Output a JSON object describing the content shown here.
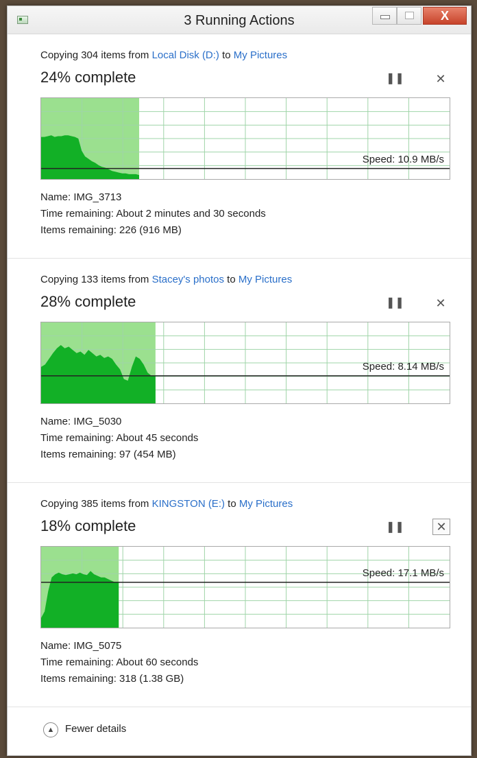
{
  "window": {
    "title": "3 Running Actions",
    "close_glyph": "X"
  },
  "operations": [
    {
      "copy_prefix": "Copying 304 items from ",
      "source": "Local Disk (D:)",
      "to": " to ",
      "destination": "My Pictures",
      "percent_text": "24% complete",
      "progress": 0.24,
      "speed_label": "Speed: 10.9 MB/s",
      "speed_level": 0.13,
      "name": "Name: IMG_3713",
      "time_remaining": "Time remaining:  About 2 minutes and 30 seconds",
      "items_remaining": "Items remaining:  226 (916 MB)",
      "history": [
        0.52,
        0.52,
        0.53,
        0.54,
        0.52,
        0.53,
        0.53,
        0.54,
        0.54,
        0.53,
        0.52,
        0.5,
        0.35,
        0.28,
        0.25,
        0.22,
        0.2,
        0.17,
        0.15,
        0.14,
        0.12,
        0.1,
        0.09,
        0.08,
        0.07,
        0.07,
        0.06,
        0.06,
        0.06,
        0.05
      ]
    },
    {
      "copy_prefix": "Copying 133 items from ",
      "source": "Stacey's photos",
      "to": " to ",
      "destination": "My Pictures",
      "percent_text": "28% complete",
      "progress": 0.28,
      "speed_label": "Speed: 8.14 MB/s",
      "speed_level": 0.34,
      "name": "Name: IMG_5030",
      "time_remaining": "Time remaining:  About 45 seconds",
      "items_remaining": "Items remaining:  97 (454 MB)",
      "history": [
        0.45,
        0.48,
        0.55,
        0.62,
        0.68,
        0.72,
        0.68,
        0.7,
        0.66,
        0.62,
        0.64,
        0.6,
        0.66,
        0.62,
        0.58,
        0.6,
        0.56,
        0.58,
        0.55,
        0.48,
        0.42,
        0.3,
        0.28,
        0.45,
        0.58,
        0.55,
        0.48,
        0.38,
        0.34,
        0.34
      ]
    },
    {
      "copy_prefix": "Copying 385 items from ",
      "source": "KINGSTON (E:)",
      "to": " to ",
      "destination": "My Pictures",
      "percent_text": "18% complete",
      "progress": 0.19,
      "speed_label": "Speed: 17.1 MB/s",
      "speed_level": 0.56,
      "name": "Name: IMG_5075",
      "time_remaining": "Time remaining:  About 60 seconds",
      "items_remaining": "Items remaining:  318 (1.38 GB)",
      "history": [
        0.12,
        0.2,
        0.45,
        0.62,
        0.66,
        0.68,
        0.66,
        0.65,
        0.66,
        0.67,
        0.66,
        0.68,
        0.66,
        0.65,
        0.7,
        0.66,
        0.64,
        0.62,
        0.62,
        0.6,
        0.58,
        0.56,
        0.56
      ]
    }
  ],
  "colors": {
    "graph_fill": "#12b026",
    "graph_bg_done": "#9be08f",
    "grid": "#9fd4a8"
  },
  "footer": {
    "label": "Fewer details",
    "icon": "chevron-up-icon"
  }
}
